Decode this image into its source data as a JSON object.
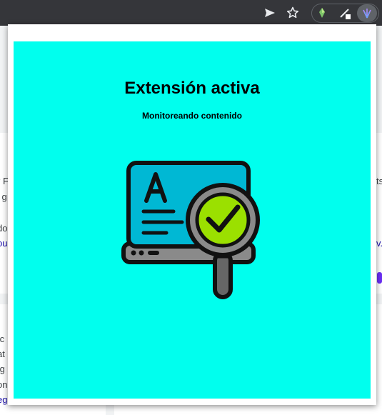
{
  "popup": {
    "title": "Extensión activa",
    "subtitle": "Monitoreando contenido",
    "background_color": "#00ffee",
    "illustration_icon": "laptop-magnifier-check-icon"
  },
  "toolbar": {
    "icons": [
      "send-tab-icon",
      "bookmark-star-icon",
      "extension-gem-icon",
      "extension-pen-icon",
      "extension-active-icon"
    ]
  },
  "background_page": {
    "fragments": [
      "r F",
      "l g",
      "do",
      "ou",
      "ts",
      "v.",
      "tc",
      "at",
      "/g",
      "on",
      "eg"
    ]
  }
}
